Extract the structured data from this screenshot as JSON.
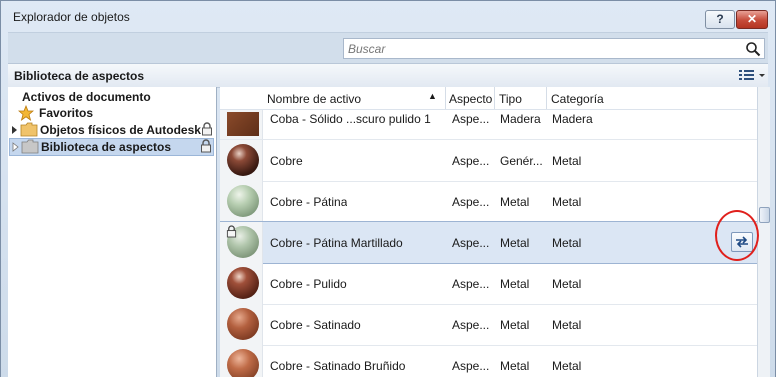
{
  "window": {
    "title": "Explorador de objetos",
    "help_label": "?",
    "close_label": "✕"
  },
  "search": {
    "placeholder": "Buscar",
    "value": ""
  },
  "library": {
    "title": "Biblioteca de aspectos"
  },
  "tree": {
    "root_label": "Activos de documento",
    "items": [
      {
        "label": "Favoritos",
        "icon": "star-icon",
        "locked": false
      },
      {
        "label": "Objetos físicos de Autodesk",
        "icon": "folder-icon",
        "locked": true
      },
      {
        "label": "Biblioteca de aspectos",
        "icon": "folder-icon",
        "locked": true,
        "selected": true
      }
    ]
  },
  "grid": {
    "columns": [
      "Nombre de activo",
      "Aspecto",
      "Tipo",
      "Categoría"
    ],
    "sort_indicator": "▲",
    "rows": [
      {
        "name": "Coba - Sólido ...scuro pulido 1",
        "aspect": "Aspe...",
        "type": "Madera",
        "category": "Madera",
        "swatch": "#7a4226"
      },
      {
        "name": "Cobre",
        "aspect": "Aspe...",
        "type": "Genér...",
        "category": "Metal",
        "swatch": "#5a2e22"
      },
      {
        "name": "Cobre - Pátina",
        "aspect": "Aspe...",
        "type": "Metal",
        "category": "Metal",
        "swatch": "#a9c2a3"
      },
      {
        "name": "Cobre - Pátina Martillado",
        "aspect": "Aspe...",
        "type": "Metal",
        "category": "Metal",
        "swatch": "#a3bb9f",
        "selected": true
      },
      {
        "name": "Cobre - Pulido",
        "aspect": "Aspe...",
        "type": "Metal",
        "category": "Metal",
        "swatch": "#6a2d20"
      },
      {
        "name": "Cobre - Satinado",
        "aspect": "Aspe...",
        "type": "Metal",
        "category": "Metal",
        "swatch": "#a2553a"
      },
      {
        "name": "Cobre - Satinado Bruñido",
        "aspect": "Aspe...",
        "type": "Metal",
        "category": "Metal",
        "swatch": "#b0603f"
      }
    ]
  },
  "colors": {
    "selection": "#dbe6f4",
    "annotation": "#e0201c"
  }
}
